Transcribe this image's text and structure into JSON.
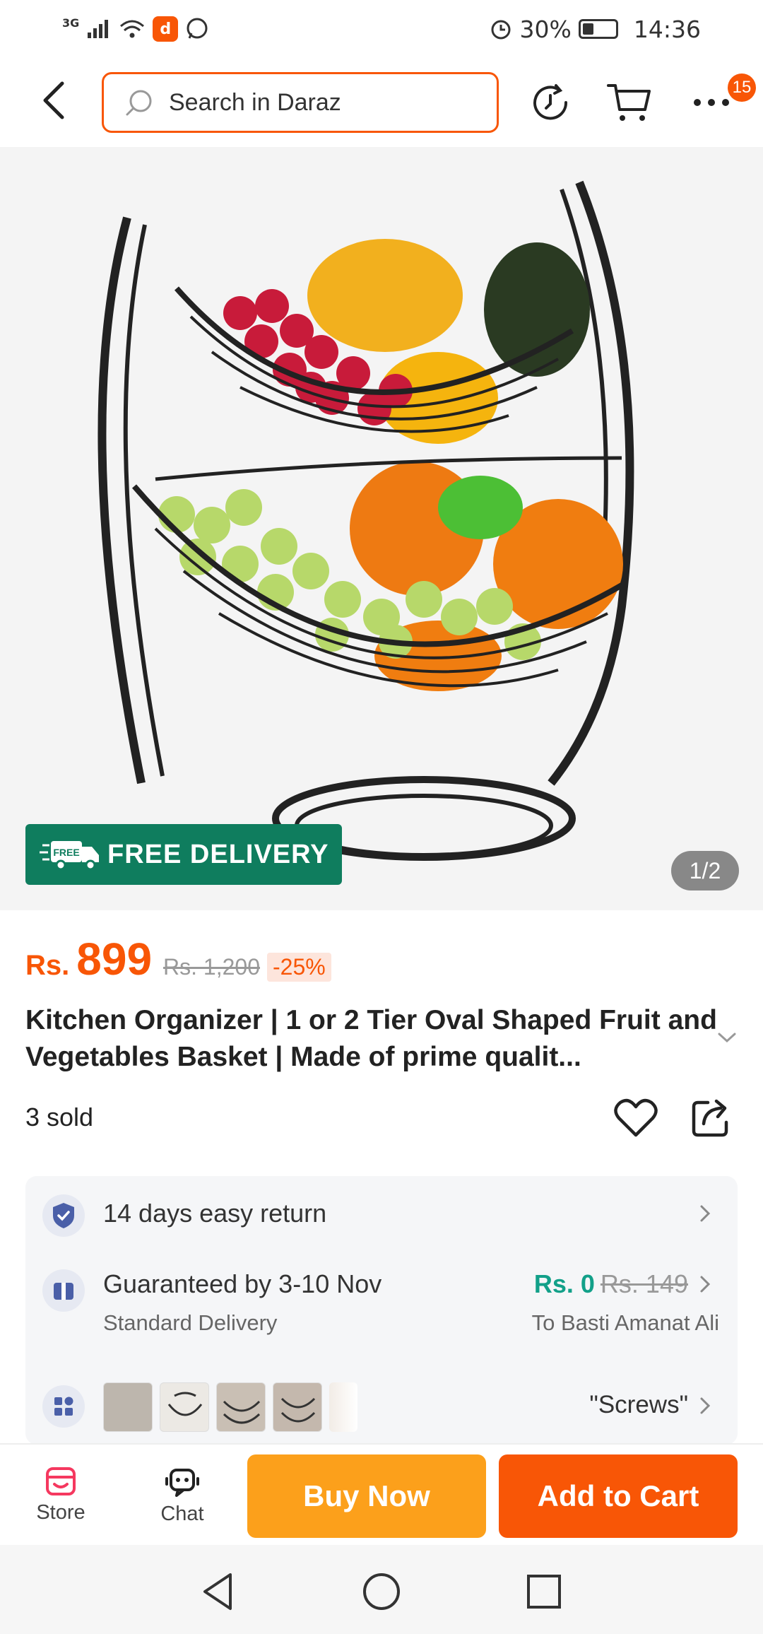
{
  "status_bar": {
    "network": "3G",
    "battery": "30%",
    "time": "14:36"
  },
  "header": {
    "search_placeholder": "Search in Daraz",
    "cart_badge": "15"
  },
  "gallery": {
    "free_delivery_label": "FREE DELIVERY",
    "free_tag": "FREE",
    "pager": "1/2"
  },
  "product": {
    "currency": "Rs.",
    "price": "899",
    "original_price": "Rs. 1,200",
    "discount": "-25%",
    "title": "Kitchen Organizer | 1 or 2 Tier Oval Shaped Fruit and Vegetables Basket | Made of prime qualit...",
    "sold": "3 sold"
  },
  "info": {
    "return_label": "14 days easy return",
    "delivery_label": "Guaranteed by 3-10 Nov",
    "delivery_type": "Standard Delivery",
    "delivery_fee": "Rs. 0",
    "delivery_fee_old": "Rs. 149",
    "destination": "To Basti Amanat Ali",
    "variant_value": "\"Screws\""
  },
  "bottom_bar": {
    "store_label": "Store",
    "chat_label": "Chat",
    "buy_now": "Buy Now",
    "add_to_cart": "Add to Cart"
  },
  "colors": {
    "brand_orange": "#f85606",
    "buy_now_yellow": "#fca01b",
    "free_delivery_green": "#0f7d5e",
    "free_fee_teal": "#12a089"
  }
}
